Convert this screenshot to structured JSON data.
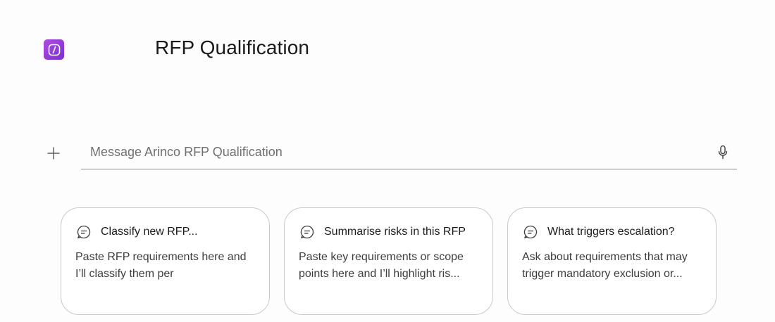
{
  "header": {
    "agent_logo_icon": "agent-code-icon",
    "title": "RFP Qualification"
  },
  "composer": {
    "add_icon": "plus-icon",
    "placeholder": "Message Arinco RFP Qualification",
    "value": "",
    "mic_icon": "microphone-icon"
  },
  "suggestions": [
    {
      "icon": "chat-bubble-icon",
      "title": "Classify new RFP...",
      "description": "Paste RFP requirements here and I’ll classify them per"
    },
    {
      "icon": "chat-bubble-icon",
      "title": "Summarise risks in this RFP",
      "description": "Paste key requirements or scope points here and I’ll highlight ris..."
    },
    {
      "icon": "chat-bubble-icon",
      "title": "What triggers escalation?",
      "description": "Ask about requirements that may trigger mandatory exclusion or..."
    }
  ],
  "colors": {
    "brand_gradient_start": "#b04ce0",
    "brand_gradient_end": "#7a2fd0",
    "background": "#fdfdfd",
    "card_border": "#c9c9c9"
  }
}
